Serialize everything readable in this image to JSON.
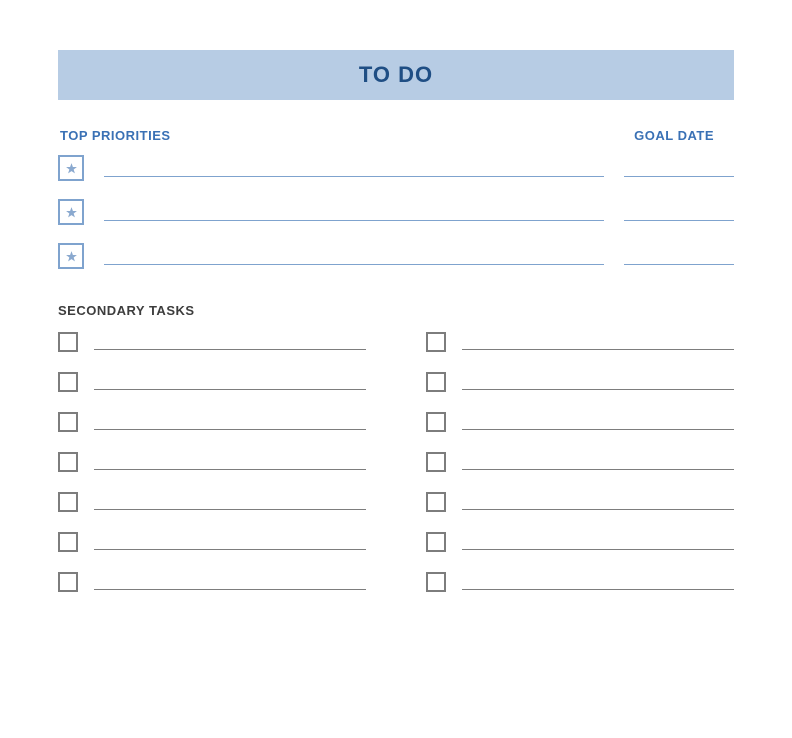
{
  "title": "TO DO",
  "labels": {
    "top_priorities": "TOP PRIORITIES",
    "goal_date": "GOAL DATE",
    "secondary_tasks": "SECONDARY TASKS"
  },
  "priorities": [
    {
      "task": "",
      "date": ""
    },
    {
      "task": "",
      "date": ""
    },
    {
      "task": "",
      "date": ""
    }
  ],
  "secondary": [
    {
      "task": ""
    },
    {
      "task": ""
    },
    {
      "task": ""
    },
    {
      "task": ""
    },
    {
      "task": ""
    },
    {
      "task": ""
    },
    {
      "task": ""
    },
    {
      "task": ""
    },
    {
      "task": ""
    },
    {
      "task": ""
    },
    {
      "task": ""
    },
    {
      "task": ""
    },
    {
      "task": ""
    },
    {
      "task": ""
    }
  ]
}
